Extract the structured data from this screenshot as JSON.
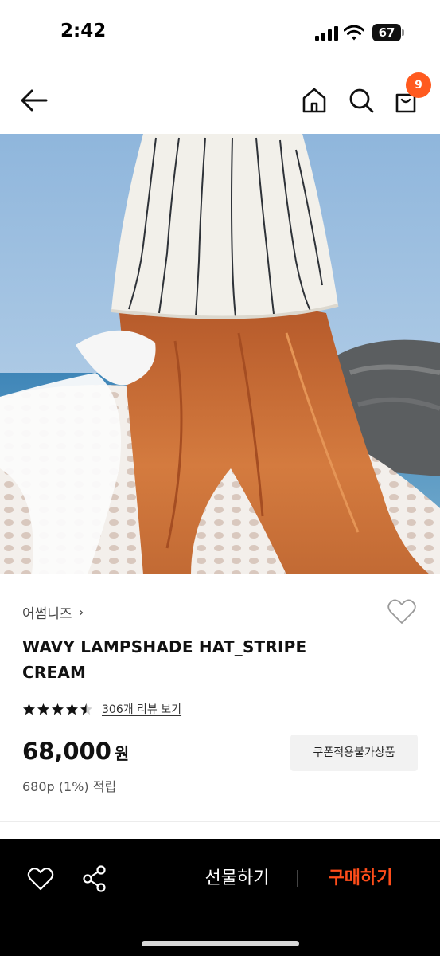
{
  "status_bar": {
    "time": "2:42",
    "battery": "67"
  },
  "header": {
    "cart_count": "9"
  },
  "product": {
    "brand": "어썸니즈",
    "brand_chevron": "›",
    "title": "WAVY LAMPSHADE HAT_STRIPE CREAM",
    "rating": 4.5,
    "reviews_link": "306개 리뷰 보기",
    "price": "68,000",
    "price_unit": "원",
    "points": "680p (1%) 적립",
    "coupon_badge": "쿠폰적용불가상품",
    "image_index": 1
  },
  "bottom_bar": {
    "gift_label": "선물하기",
    "buy_label": "구매하기"
  },
  "colors": {
    "accent": "#ff5a1f",
    "buy": "#ff4d1a",
    "bottom_bar": "#000000"
  }
}
